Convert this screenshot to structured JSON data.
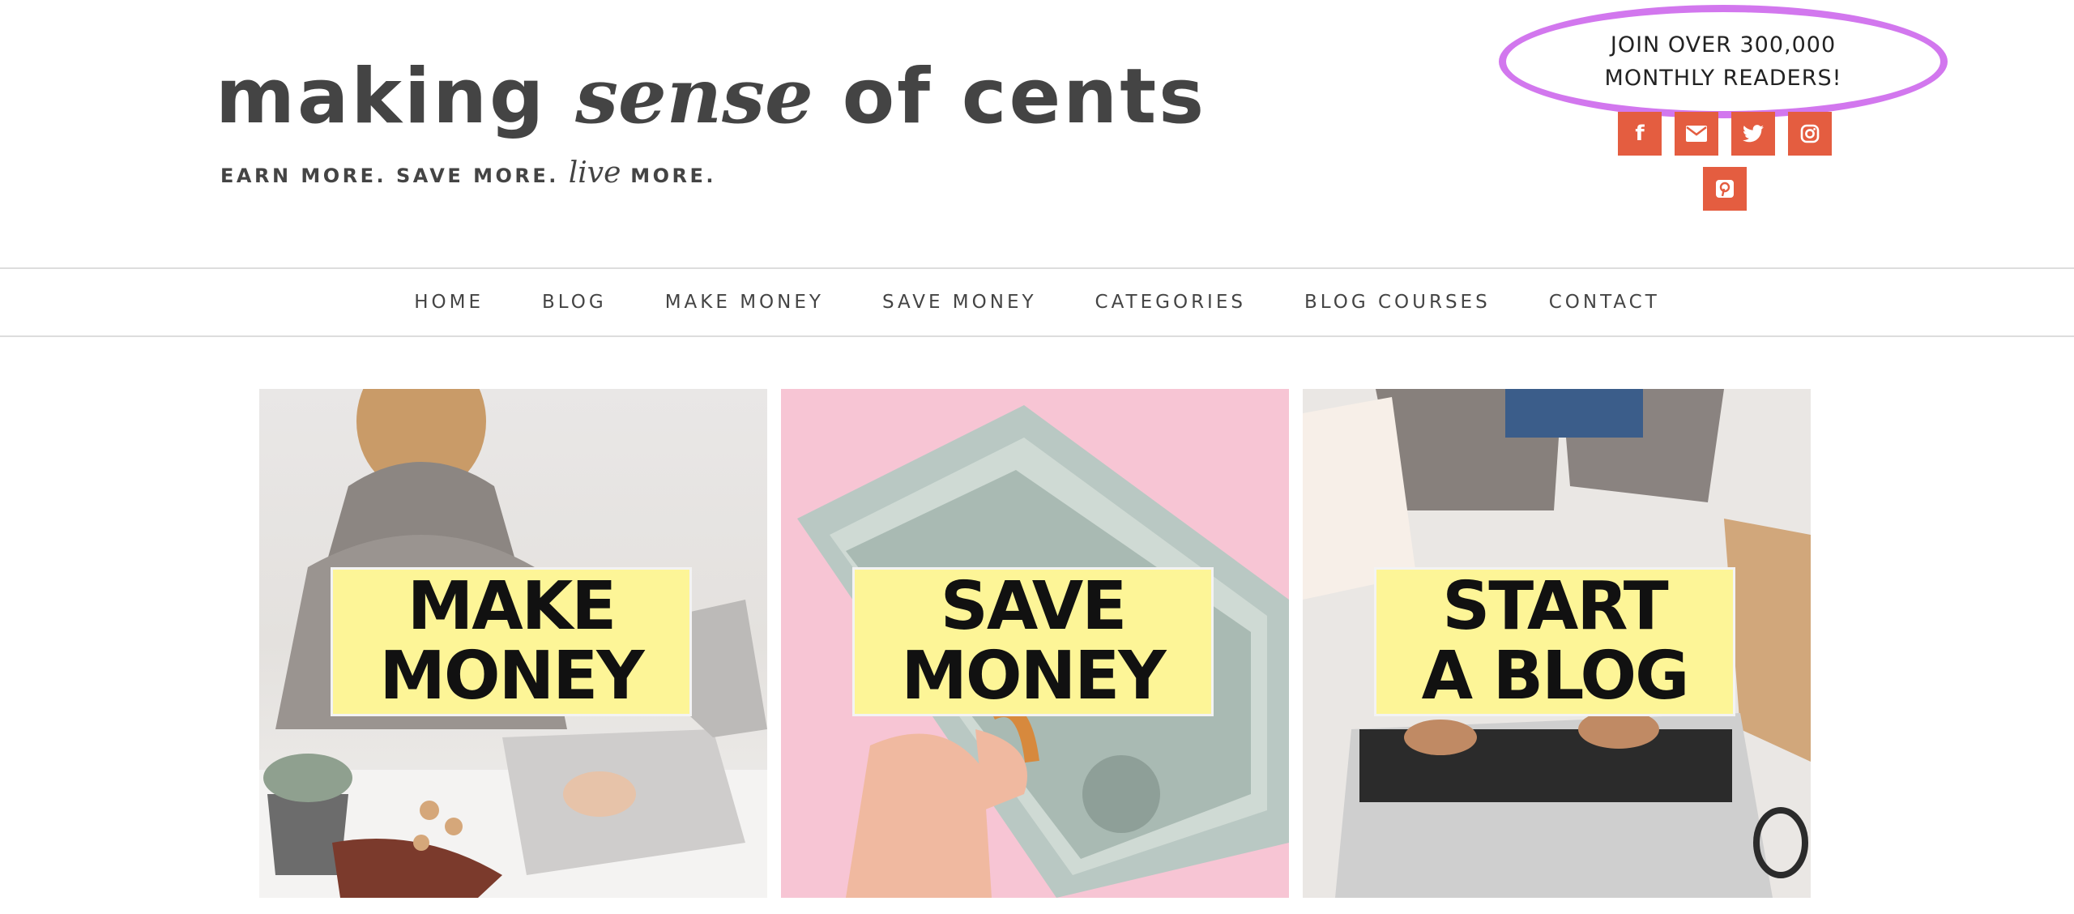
{
  "header": {
    "logo": {
      "part1": "making",
      "part2": "sense",
      "part3": "of cents",
      "tagline_part1": "EARN MORE. SAVE MORE.",
      "tagline_part2": "live",
      "tagline_part3": "MORE."
    },
    "readers": {
      "line1": "JOIN OVER 300,000",
      "line2": "MONTHLY READERS!"
    },
    "social": [
      {
        "name": "facebook-icon",
        "glyph": "f"
      },
      {
        "name": "email-icon"
      },
      {
        "name": "twitter-icon"
      },
      {
        "name": "instagram-icon"
      },
      {
        "name": "pinterest-icon"
      }
    ]
  },
  "nav": {
    "items": [
      "HOME",
      "BLOG",
      "MAKE MONEY",
      "SAVE MONEY",
      "CATEGORIES",
      "BLOG COURSES",
      "CONTACT"
    ]
  },
  "tiles": [
    {
      "line1": "MAKE",
      "line2": "MONEY"
    },
    {
      "line1": "SAVE",
      "line2": "MONEY"
    },
    {
      "line1": "START",
      "line2": "A BLOG"
    }
  ],
  "colors": {
    "accent": "#e45d40",
    "highlight_oval": "#d277ee",
    "label_bg": "#fdf597",
    "text": "#444444"
  }
}
